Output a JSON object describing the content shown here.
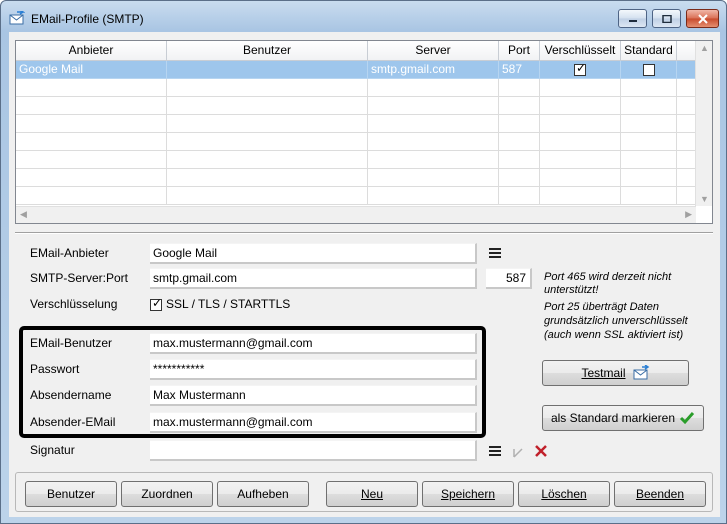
{
  "window": {
    "title": "EMail-Profile (SMTP)",
    "icon": "mail-send-icon"
  },
  "grid": {
    "columns": [
      "Anbieter",
      "Benutzer",
      "Server",
      "Port",
      "Verschlüsselt",
      "Standard"
    ],
    "rows": [
      {
        "anbieter": "Google Mail",
        "benutzer": "",
        "server": "smtp.gmail.com",
        "port": "587",
        "verschluesselt": true,
        "standard": false,
        "selected": true
      }
    ]
  },
  "form": {
    "anbieter_label": "EMail-Anbieter",
    "anbieter_value": "Google Mail",
    "server_label": "SMTP-Server:Port",
    "server_value": "smtp.gmail.com",
    "port_value": "587",
    "encryption_label": "Verschlüsselung",
    "encryption_option": "SSL / TLS / STARTTLS",
    "encryption_checked": true,
    "user_label": "EMail-Benutzer",
    "user_value": "max.mustermann@gmail.com",
    "password_label": "Passwort",
    "password_value": "***********",
    "sender_name_label": "Absendername",
    "sender_name_value": "Max Mustermann",
    "sender_email_label": "Absender-EMail",
    "sender_email_value": "max.mustermann@gmail.com",
    "signature_label": "Signatur",
    "signature_value": ""
  },
  "notes": {
    "port465_line1": "Port 465 wird derzeit nicht",
    "port465_line2": "unterstützt!",
    "port25_line1": "Port 25 überträgt Daten",
    "port25_line2": "grundsätzlich unverschlüsselt",
    "port25_line3": "(auch wenn SSL aktiviert ist)"
  },
  "side_buttons": {
    "testmail": "Testmail",
    "set_default": "als Standard markieren"
  },
  "bottom_buttons": {
    "benutzer": "Benutzer",
    "zuordnen": "Zuordnen",
    "aufheben": "Aufheben",
    "neu": "Neu",
    "speichern": "Speichern",
    "loeschen": "Löschen",
    "beenden": "Beenden"
  },
  "colors": {
    "selection": "#9ec6ec",
    "highlight_frame": "#000000",
    "delete_red": "#c0202a",
    "check_green": "#2a9d2a"
  }
}
